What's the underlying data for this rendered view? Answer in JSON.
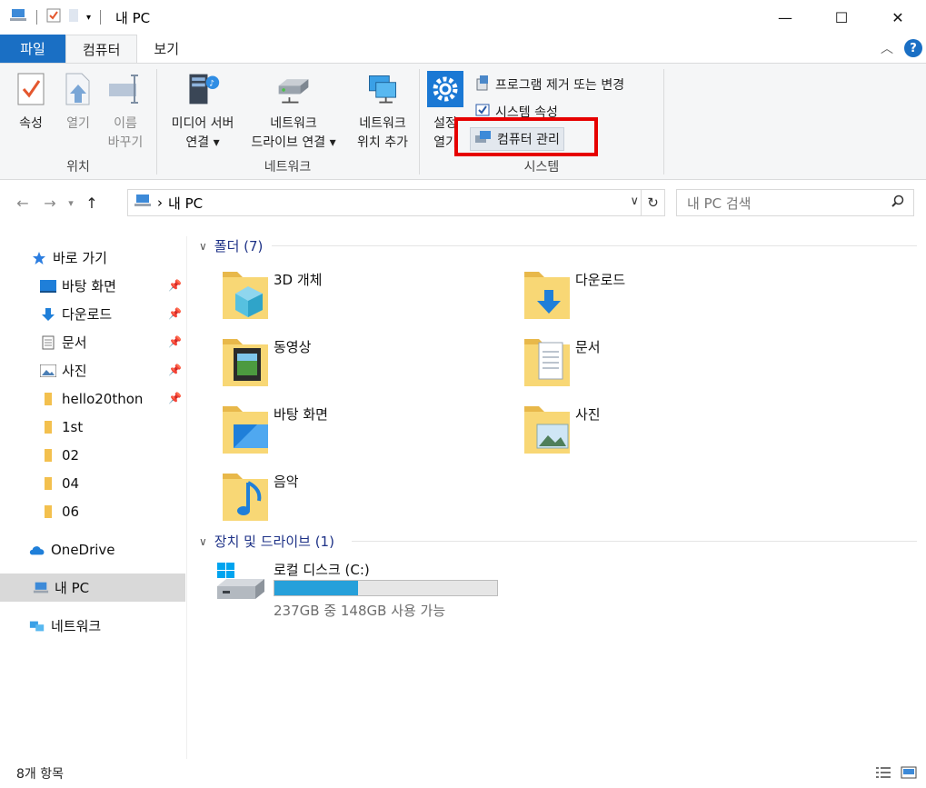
{
  "window": {
    "title": "내 PC",
    "controls": {
      "minimize": "—",
      "maximize": "☐",
      "close": "✕"
    }
  },
  "ribbon_tabs": [
    {
      "label": "파일"
    },
    {
      "label": "컴퓨터"
    },
    {
      "label": "보기"
    }
  ],
  "ribbon": {
    "groups": {
      "location": {
        "label": "위치",
        "buttons": [
          {
            "label": "속성"
          },
          {
            "label": "열기"
          },
          {
            "label": "이름\n바꾸기"
          }
        ]
      },
      "network": {
        "label": "네트워크",
        "buttons": [
          {
            "label": "미디어 서버\n연결 ▾"
          },
          {
            "label": "네트워크\n드라이브 연결 ▾"
          },
          {
            "label": "네트워크\n위치 추가"
          }
        ]
      },
      "system": {
        "label": "시스템",
        "settings_label": "설정\n열기",
        "small_buttons": [
          {
            "label": "프로그램 제거 또는 변경"
          },
          {
            "label": "시스템 속성"
          },
          {
            "label": "컴퓨터 관리"
          }
        ]
      }
    }
  },
  "address_bar": {
    "path": "내 PC",
    "separator": "›"
  },
  "search": {
    "placeholder": "내 PC 검색"
  },
  "navigation": {
    "quick_access": "바로 가기",
    "items": [
      {
        "label": "바탕 화면",
        "pinned": true
      },
      {
        "label": "다운로드",
        "pinned": true
      },
      {
        "label": "문서",
        "pinned": true
      },
      {
        "label": "사진",
        "pinned": true
      },
      {
        "label": "hello20thon",
        "pinned": true
      },
      {
        "label": "1st",
        "pinned": false
      },
      {
        "label": "02",
        "pinned": false
      },
      {
        "label": "04",
        "pinned": false
      },
      {
        "label": "06",
        "pinned": false
      }
    ],
    "onedrive": "OneDrive",
    "this_pc": "내 PC",
    "network": "네트워크"
  },
  "content": {
    "folders_header": "폴더 (7)",
    "folders": [
      {
        "name": "3D 개체",
        "icon": "3d-objects-folder-icon"
      },
      {
        "name": "다운로드",
        "icon": "downloads-folder-icon"
      },
      {
        "name": "동영상",
        "icon": "videos-folder-icon"
      },
      {
        "name": "문서",
        "icon": "documents-folder-icon"
      },
      {
        "name": "바탕 화면",
        "icon": "desktop-folder-icon"
      },
      {
        "name": "사진",
        "icon": "pictures-folder-icon"
      },
      {
        "name": "음악",
        "icon": "music-folder-icon"
      }
    ],
    "drives_header": "장치 및 드라이브 (1)",
    "drives": [
      {
        "name": "로컬 디스크 (C:)",
        "free_text": "237GB 중 148GB 사용 가능",
        "used_fraction": 0.375
      }
    ]
  },
  "status_bar": {
    "item_count": "8개 항목"
  },
  "colors": {
    "accent": "#1a6fc4",
    "highlight": "#e60000",
    "drive_fill": "#26a0da",
    "folder": "#f8d775"
  }
}
